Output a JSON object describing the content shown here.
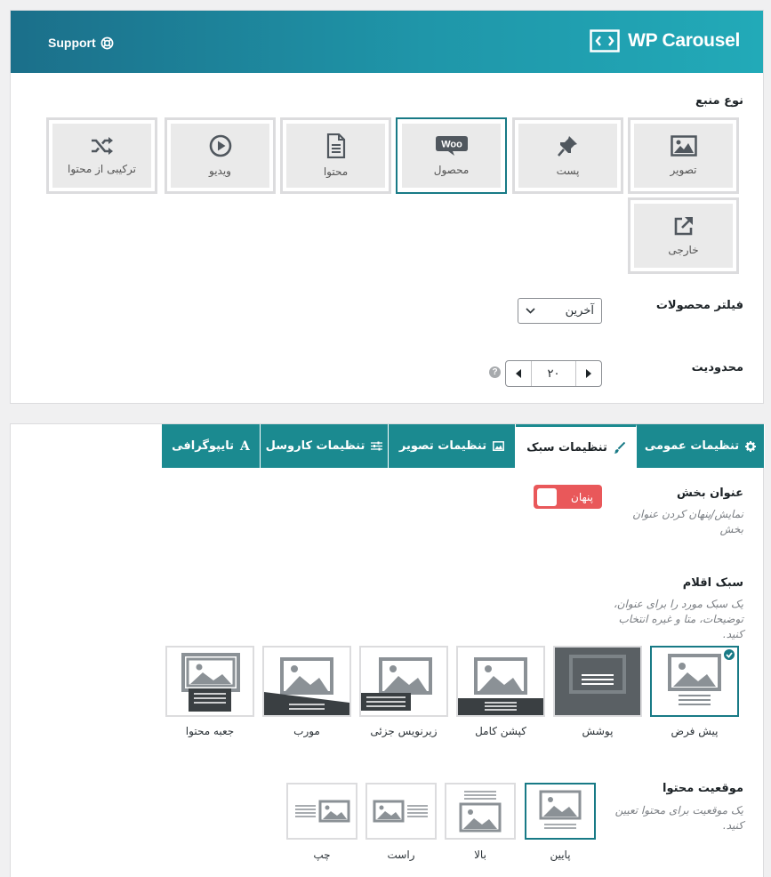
{
  "header": {
    "support_label": "Support",
    "logo_text": "WP Carousel"
  },
  "source": {
    "label": "نوع منبع",
    "types": [
      {
        "label": "تصویر",
        "icon": "image-icon"
      },
      {
        "label": "پست",
        "icon": "pin-icon"
      },
      {
        "label": "محصول",
        "icon": "woo-icon",
        "selected": true
      },
      {
        "label": "محتوا",
        "icon": "document-icon"
      },
      {
        "label": "ویدیو",
        "icon": "play-icon"
      },
      {
        "label": "ترکیبی از محتوا",
        "icon": "shuffle-icon"
      },
      {
        "label": "خارجی",
        "icon": "external-link-icon"
      }
    ],
    "woo_badge": "Woo"
  },
  "filter": {
    "label": "فیلتر محصولات",
    "selected": "آخرین"
  },
  "limit": {
    "label": "محدودیت",
    "value": "۲۰",
    "help": "?"
  },
  "tabs": [
    {
      "label": "تنظیمات عمومی",
      "icon": "gear-icon"
    },
    {
      "label": "تنظیمات سبک",
      "icon": "brush-icon",
      "active": true
    },
    {
      "label": "تنظیمات تصویر",
      "icon": "image-icon"
    },
    {
      "label": "تنظیمات کاروسل",
      "icon": "sliders-icon"
    },
    {
      "label": "تایپوگرافی",
      "icon": "font-icon",
      "glyph": "A"
    }
  ],
  "section_title": {
    "label": "عنوان بخش",
    "desc_line1": "نمایش/پنهان کردن عنوان",
    "desc_line2": "بخش",
    "toggle_text": "پنهان"
  },
  "item_style": {
    "label": "سبک اقلام",
    "desc_line1": "یک سبک مورد را برای عنوان،",
    "desc_line2": "توضیحات، متا و غیره انتخاب",
    "desc_line3": "کنید.",
    "options": [
      "پیش فرض",
      "پوشش",
      "کپشن کامل",
      "زیرنویس جزئی",
      "مورب",
      "جعبه محتوا"
    ]
  },
  "content_position": {
    "label": "موقعیت محتوا",
    "desc_line1": "یک موقعیت برای محتوا تعیین",
    "desc_line2": "کنید.",
    "options": [
      "پایین",
      "بالا",
      "راست",
      "چپ"
    ]
  },
  "colors": {
    "accent": "#187a86",
    "tab_bg": "#1b8a90",
    "toggle_off": "#e9585a"
  }
}
